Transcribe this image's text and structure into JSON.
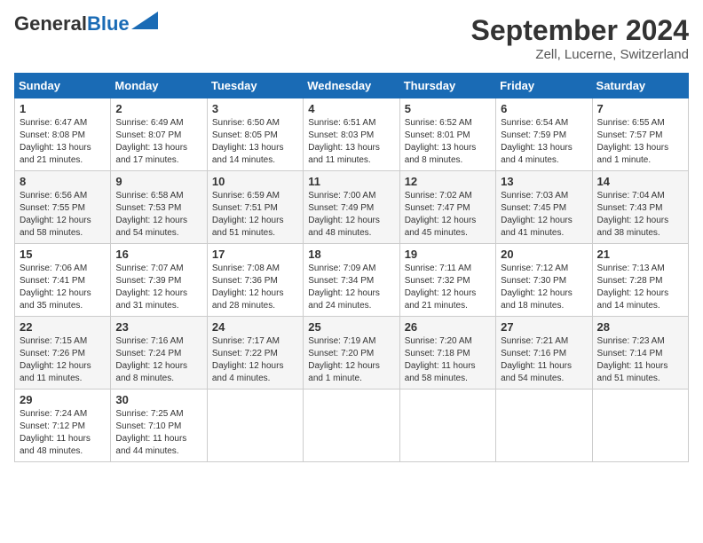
{
  "logo": {
    "general": "General",
    "blue": "Blue"
  },
  "title": {
    "month": "September 2024",
    "location": "Zell, Lucerne, Switzerland"
  },
  "headers": [
    "Sunday",
    "Monday",
    "Tuesday",
    "Wednesday",
    "Thursday",
    "Friday",
    "Saturday"
  ],
  "weeks": [
    [
      {
        "day": "1",
        "sunrise": "6:47 AM",
        "sunset": "8:08 PM",
        "daylight": "13 hours and 21 minutes."
      },
      {
        "day": "2",
        "sunrise": "6:49 AM",
        "sunset": "8:07 PM",
        "daylight": "13 hours and 17 minutes."
      },
      {
        "day": "3",
        "sunrise": "6:50 AM",
        "sunset": "8:05 PM",
        "daylight": "13 hours and 14 minutes."
      },
      {
        "day": "4",
        "sunrise": "6:51 AM",
        "sunset": "8:03 PM",
        "daylight": "13 hours and 11 minutes."
      },
      {
        "day": "5",
        "sunrise": "6:52 AM",
        "sunset": "8:01 PM",
        "daylight": "13 hours and 8 minutes."
      },
      {
        "day": "6",
        "sunrise": "6:54 AM",
        "sunset": "7:59 PM",
        "daylight": "13 hours and 4 minutes."
      },
      {
        "day": "7",
        "sunrise": "6:55 AM",
        "sunset": "7:57 PM",
        "daylight": "13 hours and 1 minute."
      }
    ],
    [
      {
        "day": "8",
        "sunrise": "6:56 AM",
        "sunset": "7:55 PM",
        "daylight": "12 hours and 58 minutes."
      },
      {
        "day": "9",
        "sunrise": "6:58 AM",
        "sunset": "7:53 PM",
        "daylight": "12 hours and 54 minutes."
      },
      {
        "day": "10",
        "sunrise": "6:59 AM",
        "sunset": "7:51 PM",
        "daylight": "12 hours and 51 minutes."
      },
      {
        "day": "11",
        "sunrise": "7:00 AM",
        "sunset": "7:49 PM",
        "daylight": "12 hours and 48 minutes."
      },
      {
        "day": "12",
        "sunrise": "7:02 AM",
        "sunset": "7:47 PM",
        "daylight": "12 hours and 45 minutes."
      },
      {
        "day": "13",
        "sunrise": "7:03 AM",
        "sunset": "7:45 PM",
        "daylight": "12 hours and 41 minutes."
      },
      {
        "day": "14",
        "sunrise": "7:04 AM",
        "sunset": "7:43 PM",
        "daylight": "12 hours and 38 minutes."
      }
    ],
    [
      {
        "day": "15",
        "sunrise": "7:06 AM",
        "sunset": "7:41 PM",
        "daylight": "12 hours and 35 minutes."
      },
      {
        "day": "16",
        "sunrise": "7:07 AM",
        "sunset": "7:39 PM",
        "daylight": "12 hours and 31 minutes."
      },
      {
        "day": "17",
        "sunrise": "7:08 AM",
        "sunset": "7:36 PM",
        "daylight": "12 hours and 28 minutes."
      },
      {
        "day": "18",
        "sunrise": "7:09 AM",
        "sunset": "7:34 PM",
        "daylight": "12 hours and 24 minutes."
      },
      {
        "day": "19",
        "sunrise": "7:11 AM",
        "sunset": "7:32 PM",
        "daylight": "12 hours and 21 minutes."
      },
      {
        "day": "20",
        "sunrise": "7:12 AM",
        "sunset": "7:30 PM",
        "daylight": "12 hours and 18 minutes."
      },
      {
        "day": "21",
        "sunrise": "7:13 AM",
        "sunset": "7:28 PM",
        "daylight": "12 hours and 14 minutes."
      }
    ],
    [
      {
        "day": "22",
        "sunrise": "7:15 AM",
        "sunset": "7:26 PM",
        "daylight": "12 hours and 11 minutes."
      },
      {
        "day": "23",
        "sunrise": "7:16 AM",
        "sunset": "7:24 PM",
        "daylight": "12 hours and 8 minutes."
      },
      {
        "day": "24",
        "sunrise": "7:17 AM",
        "sunset": "7:22 PM",
        "daylight": "12 hours and 4 minutes."
      },
      {
        "day": "25",
        "sunrise": "7:19 AM",
        "sunset": "7:20 PM",
        "daylight": "12 hours and 1 minute."
      },
      {
        "day": "26",
        "sunrise": "7:20 AM",
        "sunset": "7:18 PM",
        "daylight": "11 hours and 58 minutes."
      },
      {
        "day": "27",
        "sunrise": "7:21 AM",
        "sunset": "7:16 PM",
        "daylight": "11 hours and 54 minutes."
      },
      {
        "day": "28",
        "sunrise": "7:23 AM",
        "sunset": "7:14 PM",
        "daylight": "11 hours and 51 minutes."
      }
    ],
    [
      {
        "day": "29",
        "sunrise": "7:24 AM",
        "sunset": "7:12 PM",
        "daylight": "11 hours and 48 minutes."
      },
      {
        "day": "30",
        "sunrise": "7:25 AM",
        "sunset": "7:10 PM",
        "daylight": "11 hours and 44 minutes."
      },
      null,
      null,
      null,
      null,
      null
    ]
  ],
  "labels": {
    "sunrise": "Sunrise:",
    "sunset": "Sunset:",
    "daylight": "Daylight:"
  }
}
